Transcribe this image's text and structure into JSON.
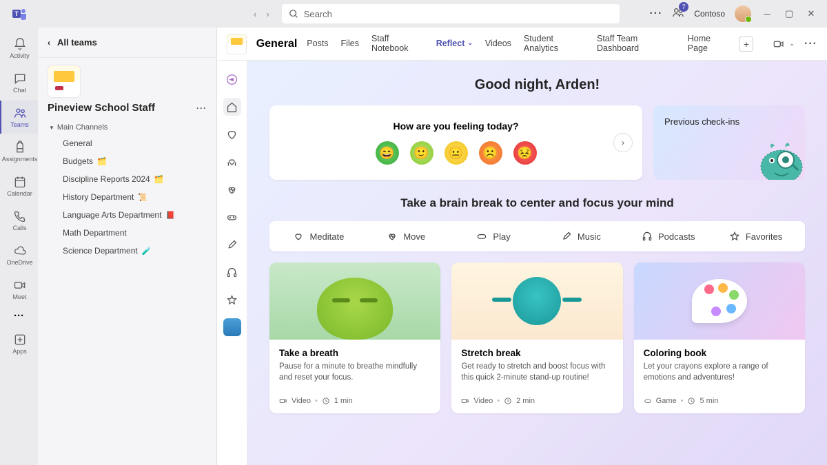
{
  "titlebar": {
    "search_placeholder": "Search",
    "notification_count": "7",
    "org_name": "Contoso"
  },
  "rail": {
    "activity": "Activity",
    "chat": "Chat",
    "teams": "Teams",
    "assignments": "Assignments",
    "calendar": "Calendar",
    "calls": "Calls",
    "onedrive": "OneDrive",
    "meet": "Meet",
    "apps": "Apps"
  },
  "panel": {
    "all_teams": "All teams",
    "team_name": "Pineview School Staff",
    "section": "Main Channels",
    "channels": [
      {
        "name": "General",
        "emo": ""
      },
      {
        "name": "Budgets",
        "emo": "🗂️"
      },
      {
        "name": "Discipline Reports 2024",
        "emo": "🗂️"
      },
      {
        "name": "History Department",
        "emo": "📜"
      },
      {
        "name": "Language Arts Department",
        "emo": "📕"
      },
      {
        "name": "Math Department",
        "emo": ""
      },
      {
        "name": "Science Department",
        "emo": "🧪"
      }
    ]
  },
  "header": {
    "channel": "General",
    "tabs": {
      "posts": "Posts",
      "files": "Files",
      "notebook": "Staff Notebook",
      "reflect": "Reflect",
      "videos": "Videos",
      "analytics": "Student Analytics",
      "dashboard": "Staff Team Dashboard",
      "home": "Home Page"
    }
  },
  "reflect": {
    "greeting": "Good night, Arden!",
    "feeling_q": "How are you feeling today?",
    "previous": "Previous check-ins",
    "brain_title": "Take a brain break to center and focus your mind",
    "tabs": {
      "meditate": "Meditate",
      "move": "Move",
      "play": "Play",
      "music": "Music",
      "podcasts": "Podcasts",
      "favorites": "Favorites"
    },
    "cards": [
      {
        "title": "Take a breath",
        "desc": "Pause for a minute to breathe mindfully and reset your focus.",
        "type": "Video",
        "dur": "1 min"
      },
      {
        "title": "Stretch break",
        "desc": "Get ready to stretch and boost focus with this quick 2-minute stand-up routine!",
        "type": "Video",
        "dur": "2 min"
      },
      {
        "title": "Coloring book",
        "desc": "Let your crayons explore a range of emotions and adventures!",
        "type": "Game",
        "dur": "5 min"
      }
    ]
  }
}
